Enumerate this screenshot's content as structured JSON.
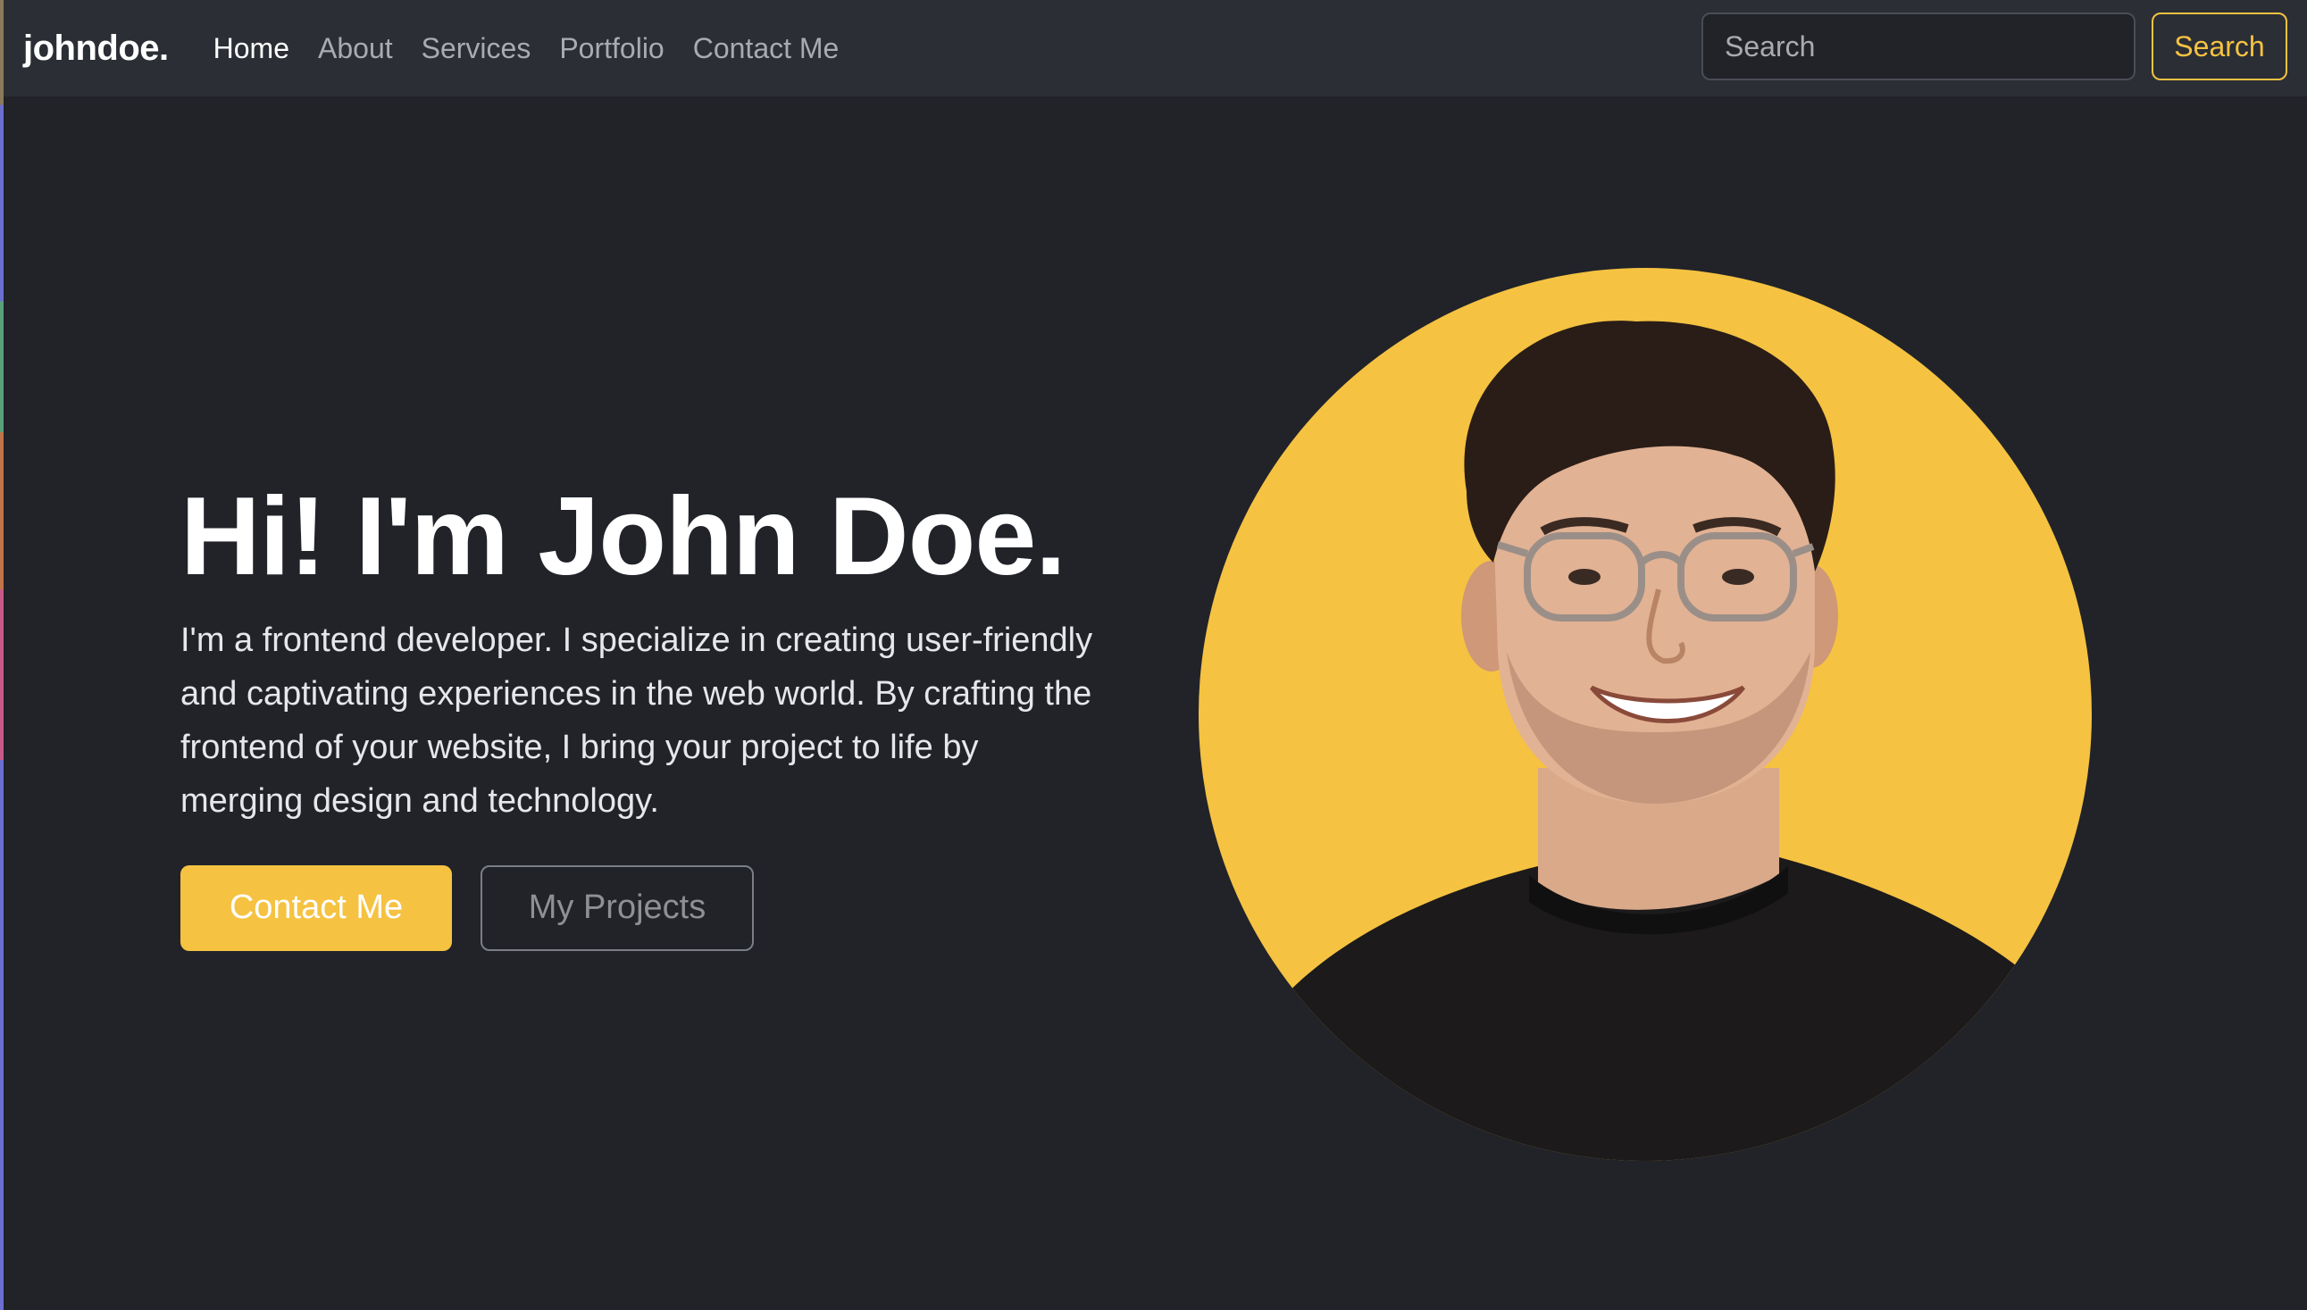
{
  "brand": "johndoe.",
  "nav": {
    "items": [
      {
        "label": "Home",
        "active": true
      },
      {
        "label": "About",
        "active": false
      },
      {
        "label": "Services",
        "active": false
      },
      {
        "label": "Portfolio",
        "active": false
      },
      {
        "label": "Contact Me",
        "active": false
      }
    ]
  },
  "search": {
    "placeholder": "Search",
    "button_label": "Search"
  },
  "hero": {
    "title": "Hi! I'm John Doe.",
    "description": "I'm a frontend developer. I specialize in creating user-friendly and captivating experiences in the web world. By crafting the frontend of your website, I bring your project to life by merging design and technology.",
    "primary_button": "Contact Me",
    "secondary_button": "My Projects"
  },
  "colors": {
    "accent": "#f5c242",
    "background": "#212329",
    "navbar": "#2b2e35"
  },
  "portrait": {
    "icon": "person-portrait"
  }
}
